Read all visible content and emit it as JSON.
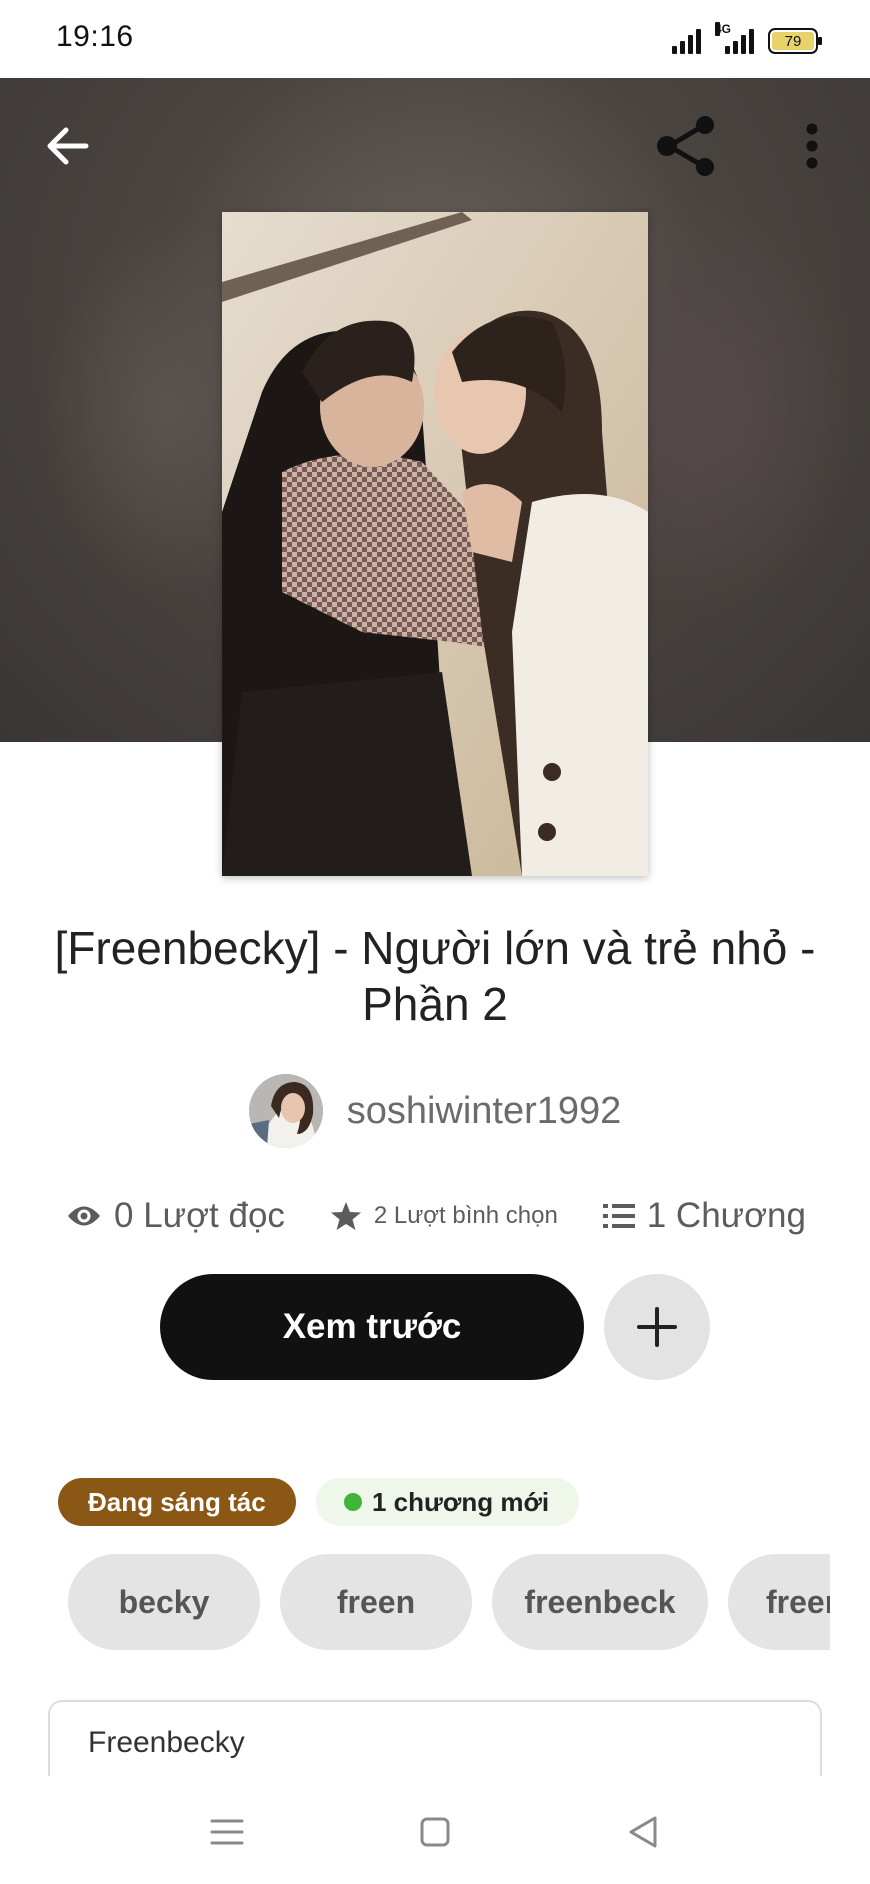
{
  "status_bar": {
    "time": "19:16",
    "network_label": "4G",
    "battery": "79"
  },
  "header": {
    "back_icon": "arrow-left-icon",
    "share_icon": "share-icon",
    "more_icon": "more-vertical-icon"
  },
  "story": {
    "title": "[Freenbecky] - Người lớn và trẻ nhỏ - Phần 2",
    "author": "soshiwinter1992",
    "stats": {
      "reads": "0 Lượt đọc",
      "votes": "2 Lượt bình chọn",
      "parts": "1 Chương"
    },
    "actions": {
      "read_label": "Xem trước",
      "add_icon": "plus-icon"
    },
    "status_badge": "Đang sáng tác",
    "new_parts_badge": "1 chương mới",
    "tags": [
      "becky",
      "freen",
      "freenbeck",
      "freer"
    ],
    "description_first_line": "Freenbecky"
  },
  "colors": {
    "status_badge_bg": "#8b5715",
    "new_badge_bg": "#eef7ea",
    "new_dot": "#41b43a",
    "primary_button": "#111111"
  },
  "nav_bar": {
    "items": [
      "menu-icon",
      "home-square-icon",
      "back-triangle-icon"
    ]
  }
}
